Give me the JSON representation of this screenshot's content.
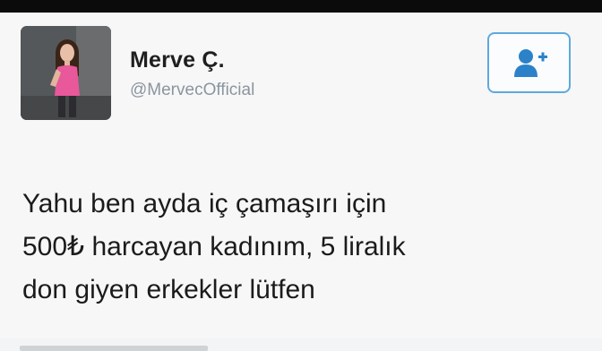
{
  "profile": {
    "name": "Merve Ç.",
    "handle": "@MervecOfficial",
    "avatar_icon": "profile-photo-icon"
  },
  "follow_button": {
    "icon": "add-user-icon",
    "accent_color": "#5fa9dd"
  },
  "tweet": {
    "lines": [
      "Yahu ben ayda iç çamaşırı için",
      "500₺ harcayan kadınım, 5 liralık",
      "don giyen erkekler lütfen"
    ]
  }
}
